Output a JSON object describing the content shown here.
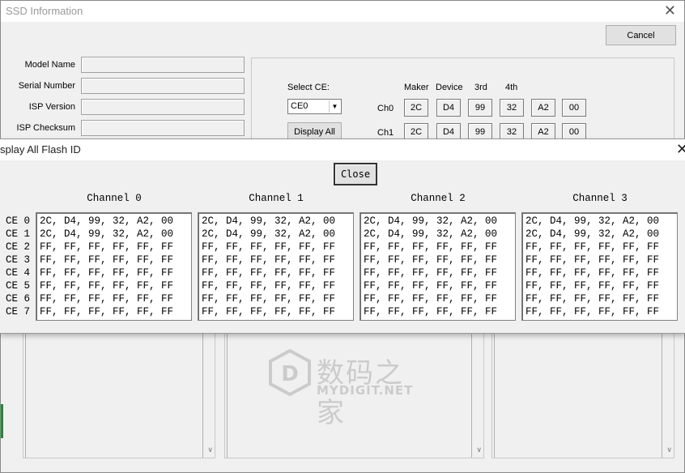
{
  "back_window": {
    "title": "SSD Information",
    "cancel_label": "Cancel",
    "labels": {
      "model_name": "Model Name",
      "serial_number": "Serial Number",
      "isp_version": "ISP Version",
      "isp_checksum": "ISP Checksum"
    },
    "select_ce_label": "Select CE:",
    "select_ce_value": "CE0",
    "display_all_label": "Display All",
    "id_headers": [
      "Maker",
      "Device",
      "3rd",
      "4th"
    ],
    "rows": [
      {
        "label": "Ch0",
        "values": [
          "2C",
          "D4",
          "99",
          "32",
          "A2",
          "00"
        ]
      },
      {
        "label": "Ch1",
        "values": [
          "2C",
          "D4",
          "99",
          "32",
          "A2",
          "00"
        ]
      }
    ],
    "watermark": {
      "title": "数码之家",
      "sub": "MYDIGIT.NET"
    }
  },
  "dialog": {
    "title": "splay All Flash ID",
    "close_label": "Close",
    "ce_labels": [
      "CE 0",
      "CE 1",
      "CE 2",
      "CE 3",
      "CE 4",
      "CE 5",
      "CE 6",
      "CE 7"
    ],
    "channels": [
      {
        "name": "Channel 0",
        "lines": [
          "2C, D4, 99, 32, A2, 00",
          "2C, D4, 99, 32, A2, 00",
          "FF, FF, FF, FF, FF, FF",
          "FF, FF, FF, FF, FF, FF",
          "FF, FF, FF, FF, FF, FF",
          "FF, FF, FF, FF, FF, FF",
          "FF, FF, FF, FF, FF, FF",
          "FF, FF, FF, FF, FF, FF"
        ]
      },
      {
        "name": "Channel 1",
        "lines": [
          "2C, D4, 99, 32, A2, 00",
          "2C, D4, 99, 32, A2, 00",
          "FF, FF, FF, FF, FF, FF",
          "FF, FF, FF, FF, FF, FF",
          "FF, FF, FF, FF, FF, FF",
          "FF, FF, FF, FF, FF, FF",
          "FF, FF, FF, FF, FF, FF",
          "FF, FF, FF, FF, FF, FF"
        ]
      },
      {
        "name": "Channel 2",
        "lines": [
          "2C, D4, 99, 32, A2, 00",
          "2C, D4, 99, 32, A2, 00",
          "FF, FF, FF, FF, FF, FF",
          "FF, FF, FF, FF, FF, FF",
          "FF, FF, FF, FF, FF, FF",
          "FF, FF, FF, FF, FF, FF",
          "FF, FF, FF, FF, FF, FF",
          "FF, FF, FF, FF, FF, FF"
        ]
      },
      {
        "name": "Channel 3",
        "lines": [
          "2C, D4, 99, 32, A2, 00",
          "2C, D4, 99, 32, A2, 00",
          "FF, FF, FF, FF, FF, FF",
          "FF, FF, FF, FF, FF, FF",
          "FF, FF, FF, FF, FF, FF",
          "FF, FF, FF, FF, FF, FF",
          "FF, FF, FF, FF, FF, FF",
          "FF, FF, FF, FF, FF, FF"
        ]
      }
    ]
  }
}
